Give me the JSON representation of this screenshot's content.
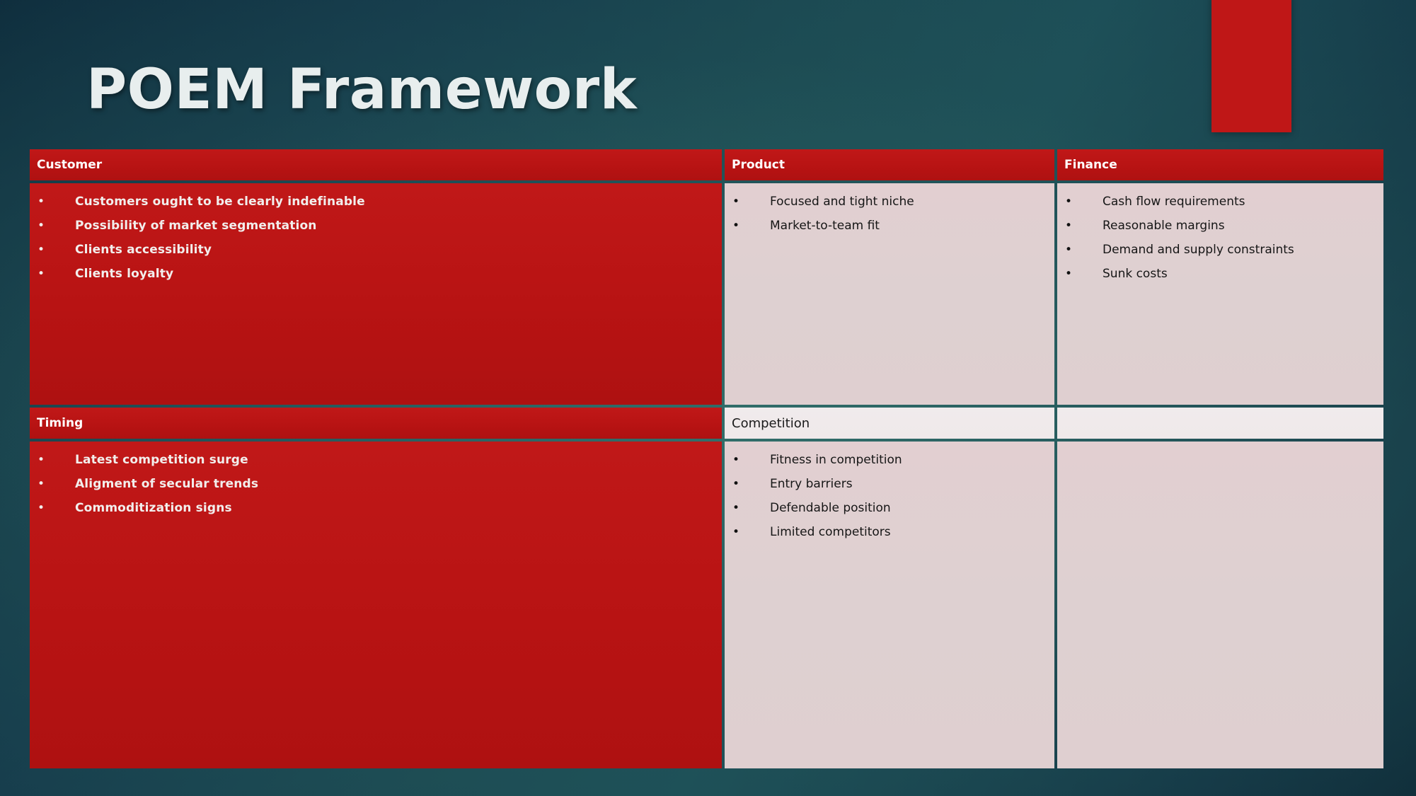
{
  "slide": {
    "title": "POEM Framework",
    "accent_color": "#bf1717",
    "background_color": "#14384a",
    "red_cell_color": "#b81313",
    "pink_cell_color": "#dfcfd0",
    "light_cell_color": "#efe9ea"
  },
  "matrix": {
    "row1": {
      "customer": {
        "header": "Customer",
        "items": [
          "Customers ought to be clearly indefinable",
          "Possibility of market segmentation",
          "Clients accessibility",
          "Clients loyalty"
        ]
      },
      "product": {
        "header": "Product",
        "items": [
          "Focused and tight niche",
          "Market-to-team fit"
        ]
      },
      "finance": {
        "header": "Finance",
        "items": [
          "Cash flow requirements",
          "Reasonable margins",
          "Demand and supply constraints",
          "Sunk costs"
        ]
      }
    },
    "row2": {
      "timing": {
        "header": "Timing",
        "items": [
          "Latest competition surge",
          "Aligment of secular trends",
          "Commoditization signs"
        ]
      },
      "competition": {
        "header": "Competition",
        "items": [
          "Fitness in competition",
          "Entry barriers",
          "Defendable position",
          "Limited competitors"
        ]
      },
      "blank": {
        "header": "",
        "items": []
      }
    }
  },
  "bullet_glyph": "•"
}
